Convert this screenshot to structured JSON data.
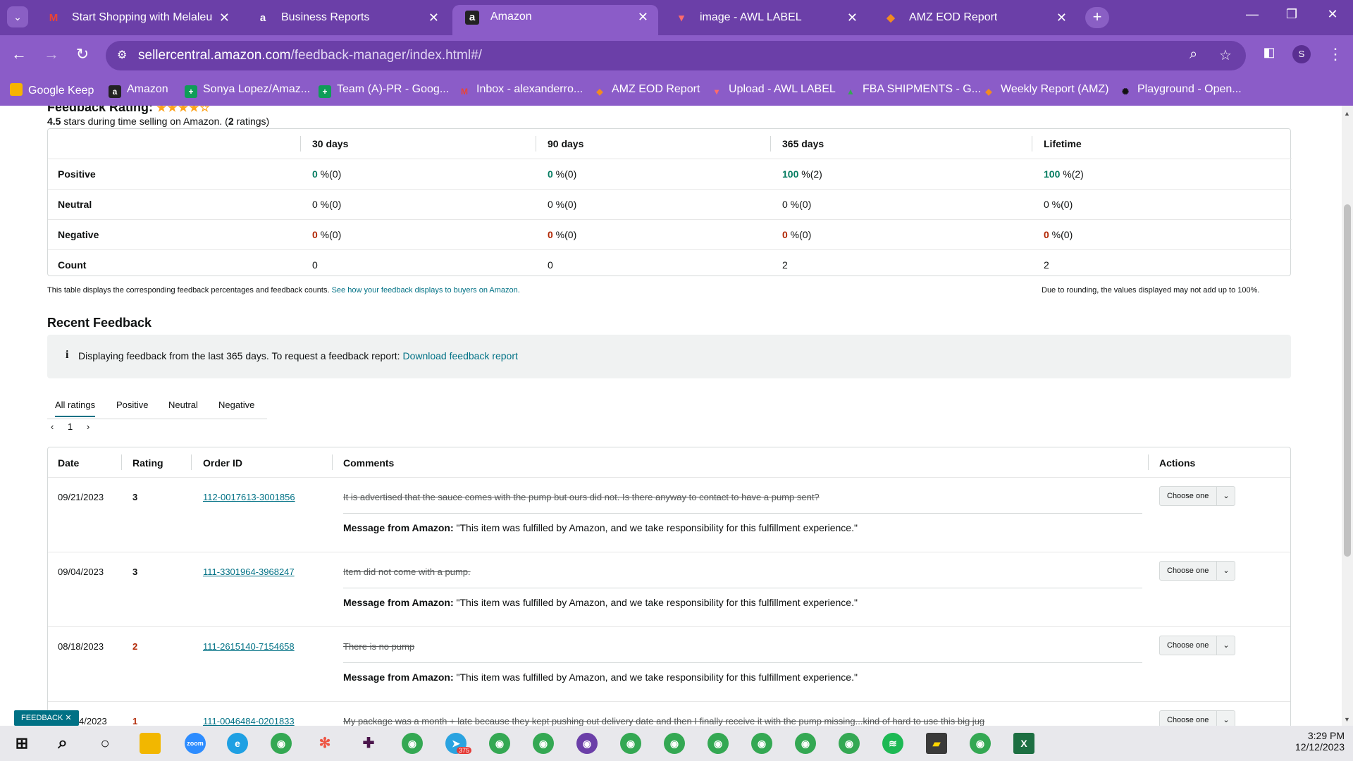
{
  "browser": {
    "tabs": [
      {
        "title": "Start Shopping with Melaleuca",
        "icon": "M",
        "active": false
      },
      {
        "title": "Business Reports",
        "icon": "a",
        "active": false
      },
      {
        "title": "Amazon",
        "icon": "a",
        "active": true
      },
      {
        "title": "image - AWL LABEL",
        "icon": "W",
        "active": false
      },
      {
        "title": "AMZ EOD Report",
        "icon": "Z",
        "active": false
      }
    ],
    "url_host": "sellercentral.amazon.com",
    "url_path": "/feedback-manager/index.html#/",
    "profile_initial": "S",
    "bookmarks": [
      {
        "label": "Google Keep",
        "color": "#f6b400"
      },
      {
        "label": "Amazon",
        "color": "#222222"
      },
      {
        "label": "Sonya Lopez/Amaz...",
        "color": "#0f9d58"
      },
      {
        "label": "Team (A)-PR - Goog...",
        "color": "#0f9d58"
      },
      {
        "label": "Inbox - alexanderro...",
        "color": "#ea4335"
      },
      {
        "label": "AMZ EOD Report",
        "color": "#f28b20"
      },
      {
        "label": "Upload - AWL LABEL",
        "color": "#c5221f"
      },
      {
        "label": "FBA SHIPMENTS - G...",
        "color": "#34a853"
      },
      {
        "label": "Weekly Report (AMZ)",
        "color": "#f28b20"
      },
      {
        "label": "Playground - Open...",
        "color": "#111111"
      }
    ]
  },
  "feedback": {
    "heading": "Feedback Rating:",
    "stars_display": "★★★★☆",
    "summary_rating": "4.5",
    "summary_text_mid": " stars during time selling on Amazon. (",
    "summary_count": "2",
    "summary_text_end": " ratings)",
    "columns": [
      "30 days",
      "90 days",
      "365 days",
      "Lifetime"
    ],
    "rows": [
      {
        "label": "Positive",
        "values": [
          {
            "num": "0",
            "rest": " %(0)"
          },
          {
            "num": "0",
            "rest": " %(0)"
          },
          {
            "num": "100",
            "rest": " %(2)"
          },
          {
            "num": "100",
            "rest": " %(2)"
          }
        ]
      },
      {
        "label": "Neutral",
        "values": [
          {
            "num": "0",
            "rest": " %(0)"
          },
          {
            "num": "0",
            "rest": " %(0)"
          },
          {
            "num": "0",
            "rest": " %(0)"
          },
          {
            "num": "0",
            "rest": " %(0)"
          }
        ]
      },
      {
        "label": "Negative",
        "values": [
          {
            "num": "0",
            "rest": " %(0)"
          },
          {
            "num": "0",
            "rest": " %(0)"
          },
          {
            "num": "0",
            "rest": " %(0)"
          },
          {
            "num": "0",
            "rest": " %(0)"
          }
        ]
      },
      {
        "label": "Count",
        "values": [
          {
            "num": "0",
            "rest": ""
          },
          {
            "num": "0",
            "rest": ""
          },
          {
            "num": "2",
            "rest": ""
          },
          {
            "num": "2",
            "rest": ""
          }
        ]
      }
    ],
    "note_left": "This table displays the corresponding feedback percentages and feedback counts. ",
    "note_left_link": "See how your feedback displays to buyers on Amazon.",
    "note_right": "Due to rounding, the values displayed may not add up to 100%."
  },
  "recent": {
    "title": "Recent Feedback",
    "info_text": "Displaying feedback from the last 365 days. To request a feedback report: ",
    "info_link": "Download feedback report",
    "filter_tabs": [
      "All ratings",
      "Positive",
      "Neutral",
      "Negative"
    ],
    "page_number": "1",
    "table_headers": [
      "Date",
      "Rating",
      "Order ID",
      "Comments",
      "Actions"
    ],
    "message_label": "Message from Amazon:",
    "action_label": "Choose one",
    "entries": [
      {
        "date": "09/21/2023",
        "rating": "3",
        "order_id": "112-0017613-3001856",
        "comment": "It is advertised that the sauce comes with the pump but ours did not. Is there anyway to contact to have a pump sent?",
        "message": " \"This item was fulfilled by Amazon, and we take responsibility for this fulfillment experience.\""
      },
      {
        "date": "09/04/2023",
        "rating": "3",
        "order_id": "111-3301964-3968247",
        "comment": "Item did not come with a pump.",
        "message": " \"This item was fulfilled by Amazon, and we take responsibility for this fulfillment experience.\""
      },
      {
        "date": "08/18/2023",
        "rating": "2",
        "order_id": "111-2615140-7154658",
        "comment": "There is no pump",
        "message": " \"This item was fulfilled by Amazon, and we take responsibility for this fulfillment experience.\""
      },
      {
        "date": "4/2023",
        "rating": "1",
        "order_id": "111-0046484-0201833",
        "comment": "My package was a month + late because they kept pushing out delivery date and then I finally receive it with the pump missing...kind of hard to use this big jug",
        "message": ""
      }
    ],
    "feedback_badge": "FEEDBACK ✕"
  },
  "taskbar": {
    "time": "3:29 PM",
    "date": "12/12/2023",
    "telegram_badge": "375"
  }
}
